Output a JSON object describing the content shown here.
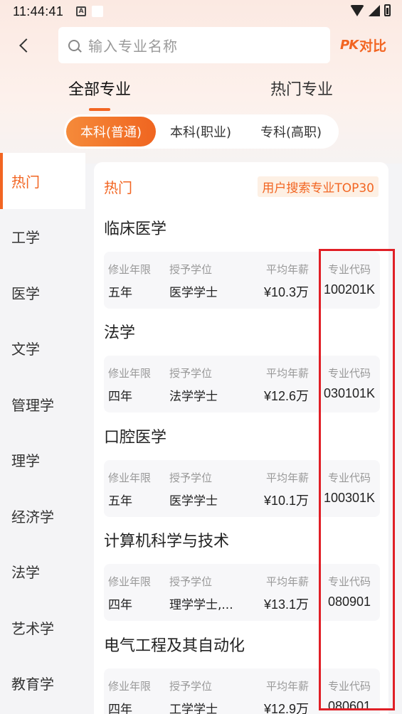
{
  "status_bar": {
    "time": "11:44:41",
    "notif_icon": "A"
  },
  "header": {
    "search_placeholder": "输入专业名称",
    "pk_logo": "PK",
    "pk_label": "对比"
  },
  "main_tabs": [
    {
      "label": "全部专业",
      "active": true
    },
    {
      "label": "热门专业",
      "active": false
    }
  ],
  "sub_tabs": [
    {
      "label": "本科(普通)",
      "active": true
    },
    {
      "label": "本科(职业)",
      "active": false
    },
    {
      "label": "专科(高职)",
      "active": false
    }
  ],
  "sidebar": {
    "items": [
      {
        "label": "热门",
        "active": true
      },
      {
        "label": "工学"
      },
      {
        "label": "医学"
      },
      {
        "label": "文学"
      },
      {
        "label": "管理学"
      },
      {
        "label": "理学"
      },
      {
        "label": "经济学"
      },
      {
        "label": "法学"
      },
      {
        "label": "艺术学"
      },
      {
        "label": "教育学"
      }
    ]
  },
  "content": {
    "section_title": "热门",
    "badge": "用户搜索专业TOP30",
    "labels": {
      "years": "修业年限",
      "degree": "授予学位",
      "salary": "平均年薪",
      "code": "专业代码"
    },
    "majors": [
      {
        "name": "临床医学",
        "years": "五年",
        "degree": "医学学士",
        "salary": "¥10.3万",
        "code": "100201K"
      },
      {
        "name": "法学",
        "years": "四年",
        "degree": "法学学士",
        "salary": "¥12.6万",
        "code": "030101K"
      },
      {
        "name": "口腔医学",
        "years": "五年",
        "degree": "医学学士",
        "salary": "¥10.1万",
        "code": "100301K"
      },
      {
        "name": "计算机科学与技术",
        "years": "四年",
        "degree": "理学学士,...",
        "salary": "¥13.1万",
        "code": "080901"
      },
      {
        "name": "电气工程及其自动化",
        "years": "四年",
        "degree": "工学学士",
        "salary": "¥12.9万",
        "code": "080601"
      }
    ]
  },
  "colors": {
    "accent": "#f26522",
    "highlight_box": "#e01f26"
  }
}
